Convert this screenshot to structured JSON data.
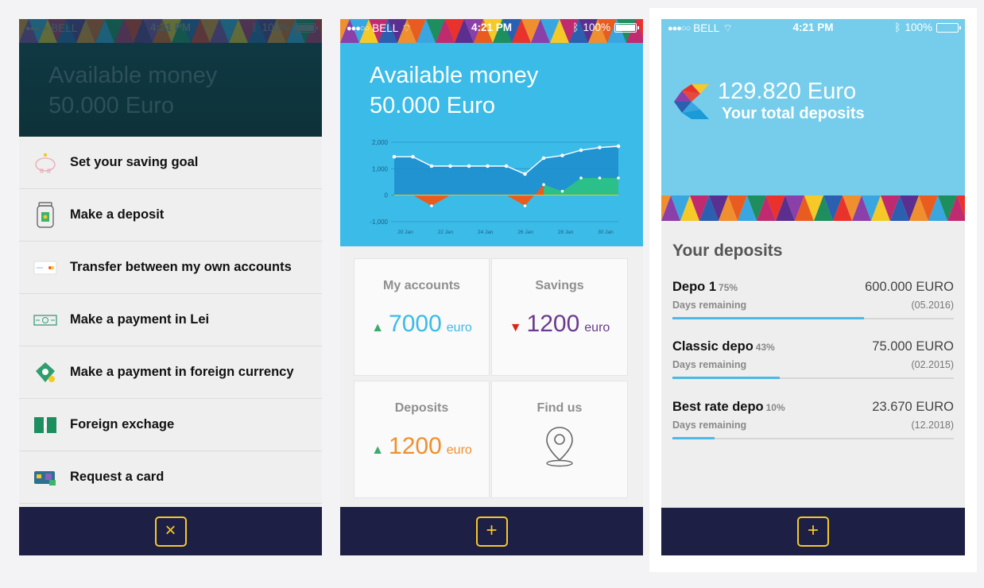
{
  "status": {
    "carrier": "BELL",
    "time": "4:21 PM",
    "battery": "100%"
  },
  "screen1": {
    "title_line1": "Available money",
    "title_line2": "50.000 Euro",
    "menu": [
      {
        "label": "Set your saving goal",
        "icon": "piggy-bank-icon"
      },
      {
        "label": "Make a deposit",
        "icon": "jar-icon"
      },
      {
        "label": "Transfer between my own accounts",
        "icon": "card-icon"
      },
      {
        "label": "Make a payment in Lei",
        "icon": "banknote-icon"
      },
      {
        "label": "Make a payment in foreign currency",
        "icon": "money-stack-icon"
      },
      {
        "label": "Foreign exchage",
        "icon": "exchange-icon"
      },
      {
        "label": "Request a card",
        "icon": "credit-card-icon"
      }
    ],
    "close_button": "×"
  },
  "screen2": {
    "title_line1": "Available money",
    "title_line2": "50.000 Euro",
    "tiles": {
      "accounts": {
        "title": "My accounts",
        "arrow": "▲",
        "value": "7000",
        "unit": "euro"
      },
      "savings": {
        "title": "Savings",
        "arrow": "▼",
        "value": "1200",
        "unit": "euro"
      },
      "deposits": {
        "title": "Deposits",
        "arrow": "▲",
        "value": "1200",
        "unit": "euro"
      },
      "findus": {
        "title": "Find us"
      }
    },
    "add_button": "+",
    "chart_data": {
      "type": "area",
      "x": [
        "20 Jan",
        "22 Jan",
        "24 Jan",
        "26 Jan",
        "28 Jan",
        "30 Jan"
      ],
      "yticks": [
        "2,000",
        "1,000",
        "0",
        "-1,000"
      ],
      "ylim": [
        -1000,
        2000
      ],
      "series": [
        {
          "values": [
            1450,
            1450,
            1100,
            1100,
            1100,
            1100,
            1100,
            800,
            1400,
            1500,
            1700,
            1800,
            1850
          ],
          "color": "#1f8fce"
        },
        {
          "values": [
            0,
            0,
            -400,
            0,
            0,
            0,
            0,
            -400,
            400,
            150,
            650,
            650,
            650
          ],
          "color": "#e85c1f"
        }
      ]
    }
  },
  "screen3": {
    "total_amount": "129.820 Euro",
    "total_label": "Your total deposits",
    "section_title": "Your deposits",
    "deposits": [
      {
        "name": "Depo 1",
        "pct": "75%",
        "amount": "600.000 EURO",
        "days_label": "Days remaining",
        "date": "(05.2016)",
        "progress": 0.68
      },
      {
        "name": "Classic depo",
        "pct": "43%",
        "amount": "75.000 EURO",
        "days_label": "Days remaining",
        "date": "(02.2015)",
        "progress": 0.38
      },
      {
        "name": "Best rate depo",
        "pct": "10%",
        "amount": "23.670 EURO",
        "days_label": "Days remaining",
        "date": "(12.2018)",
        "progress": 0.15
      }
    ],
    "add_button": "+"
  }
}
